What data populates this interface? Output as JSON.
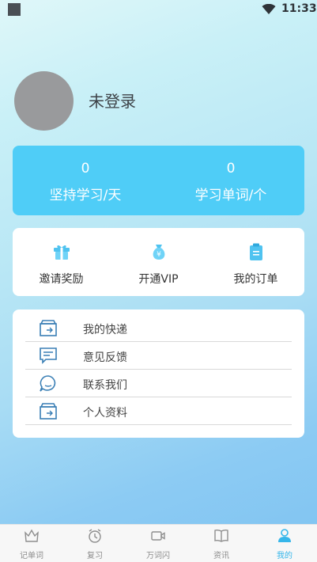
{
  "status_bar": {
    "time": "11:33"
  },
  "profile": {
    "login_status": "未登录"
  },
  "stats": [
    {
      "value": "0",
      "label": "坚持学习/天"
    },
    {
      "value": "0",
      "label": "学习单词/个"
    }
  ],
  "quick_actions": [
    {
      "label": "邀请奖励",
      "icon": "gift-icon"
    },
    {
      "label": "开通VIP",
      "icon": "money-bag-icon"
    },
    {
      "label": "我的订单",
      "icon": "clipboard-icon"
    }
  ],
  "menu": [
    {
      "label": "我的快递",
      "icon": "express-box-icon"
    },
    {
      "label": "意见反馈",
      "icon": "feedback-icon"
    },
    {
      "label": "联系我们",
      "icon": "chat-icon"
    },
    {
      "label": "个人资料",
      "icon": "profile-box-icon"
    }
  ],
  "tabbar": {
    "active_index": 4,
    "active_color": "#36b6ea",
    "items": [
      {
        "label": "记单词",
        "icon": "crown-icon"
      },
      {
        "label": "复习",
        "icon": "clock-icon"
      },
      {
        "label": "万词闪",
        "icon": "video-icon"
      },
      {
        "label": "资讯",
        "icon": "book-icon"
      },
      {
        "label": "我的",
        "icon": "person-icon"
      }
    ]
  },
  "colors": {
    "stats_card": "#4fcdf7",
    "accent": "#36b6ea",
    "avatar": "#999a9c"
  }
}
